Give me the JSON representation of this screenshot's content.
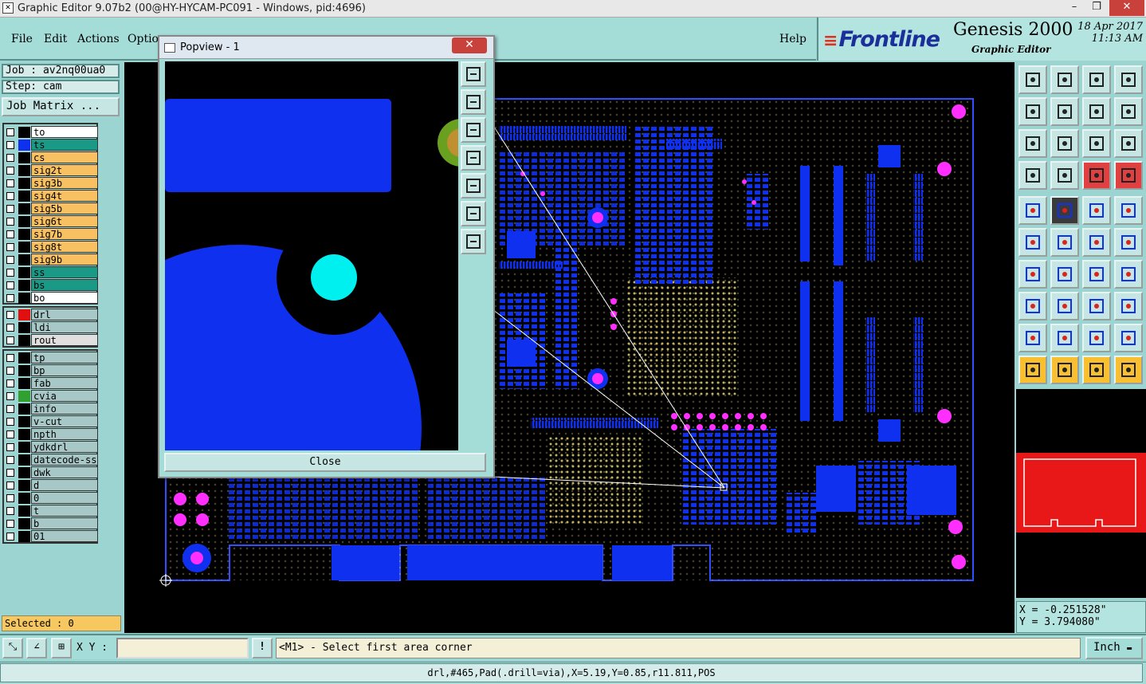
{
  "window": {
    "title": "Graphic Editor 9.07b2 (00@HY-HYCAM-PC091 - Windows, pid:4696)",
    "minimize": "–",
    "maximize": "❐",
    "close": "✕"
  },
  "menu": {
    "file": "File",
    "edit": "Edit",
    "actions": "Actions",
    "options": "Options",
    "help": "Help"
  },
  "brand": {
    "logo": "Frontline",
    "product": "Genesis 2000",
    "subtitle": "Graphic Editor",
    "date": "18 Apr 2017",
    "time": "11:13 AM"
  },
  "job": {
    "job_label": "Job : av2nq00ua0",
    "step_label": "Step: cam",
    "matrix_button": "Job Matrix ..."
  },
  "layers_board": [
    {
      "name": "to",
      "color": "#000000",
      "bg": "#ffffff"
    },
    {
      "name": "ts",
      "color": "#1030f0",
      "bg": "#1a9a86"
    },
    {
      "name": "cs",
      "color": "#000000",
      "bg": "#f8c060"
    },
    {
      "name": "sig2t",
      "color": "#000000",
      "bg": "#f8c060"
    },
    {
      "name": "sig3b",
      "color": "#000000",
      "bg": "#f8c060"
    },
    {
      "name": "sig4t",
      "color": "#000000",
      "bg": "#f8c060"
    },
    {
      "name": "sig5b",
      "color": "#000000",
      "bg": "#f8c060"
    },
    {
      "name": "sig6t",
      "color": "#000000",
      "bg": "#f8c060"
    },
    {
      "name": "sig7b",
      "color": "#000000",
      "bg": "#f8c060"
    },
    {
      "name": "sig8t",
      "color": "#000000",
      "bg": "#f8c060"
    },
    {
      "name": "sig9b",
      "color": "#000000",
      "bg": "#f8c060"
    },
    {
      "name": "ss",
      "color": "#000000",
      "bg": "#1a9a86"
    },
    {
      "name": "bs",
      "color": "#000000",
      "bg": "#1a9a86"
    },
    {
      "name": "bo",
      "color": "#000000",
      "bg": "#ffffff"
    }
  ],
  "layers_drill": [
    {
      "name": "drl",
      "color": "#e01010",
      "bg": "#a8c8c8"
    },
    {
      "name": "ldi",
      "color": "#000000",
      "bg": "#a8c8c8"
    },
    {
      "name": "rout",
      "color": "#000000",
      "bg": "#e0e0e0"
    }
  ],
  "layers_misc": [
    {
      "name": "tp",
      "color": "#000000",
      "bg": "#a8c8c8"
    },
    {
      "name": "bp",
      "color": "#000000",
      "bg": "#a8c8c8"
    },
    {
      "name": "fab",
      "color": "#000000",
      "bg": "#a8c8c8"
    },
    {
      "name": "cvia",
      "color": "#30a030",
      "bg": "#a8c8c8"
    },
    {
      "name": "info",
      "color": "#000000",
      "bg": "#a8c8c8"
    },
    {
      "name": "v-cut",
      "color": "#000000",
      "bg": "#a8c8c8"
    },
    {
      "name": "npth",
      "color": "#000000",
      "bg": "#a8c8c8"
    },
    {
      "name": "ydkdrl",
      "color": "#000000",
      "bg": "#a8c8c8"
    },
    {
      "name": "datecode-ss",
      "color": "#000000",
      "bg": "#a8c8c8"
    },
    {
      "name": "dwk",
      "color": "#000000",
      "bg": "#a8c8c8"
    },
    {
      "name": "d",
      "color": "#000000",
      "bg": "#a8c8c8"
    },
    {
      "name": "0",
      "color": "#000000",
      "bg": "#a8c8c8"
    },
    {
      "name": "t",
      "color": "#000000",
      "bg": "#a8c8c8"
    },
    {
      "name": "b",
      "color": "#000000",
      "bg": "#a8c8c8"
    },
    {
      "name": "01",
      "color": "#000000",
      "bg": "#a8c8c8"
    }
  ],
  "selected": "Selected : 0",
  "popup": {
    "title": "Popview - 1",
    "close_x": "✕",
    "close_button": "Close"
  },
  "coords": {
    "x": "X = -0.251528\"",
    "y": "Y = 3.794080\""
  },
  "bottom": {
    "xy_label": "X Y :",
    "xy_value": "",
    "alert": "!",
    "prompt": "<M1> - Select first area corner",
    "unit": "Inch"
  },
  "status": "drl,#465,Pad(.drill=via),X=5.19,Y=0.85,r11.811,POS",
  "colors": {
    "copper": "#1030f0",
    "drill": "#ff30ff",
    "background": "#000000",
    "panel": "#9bd4d0"
  }
}
